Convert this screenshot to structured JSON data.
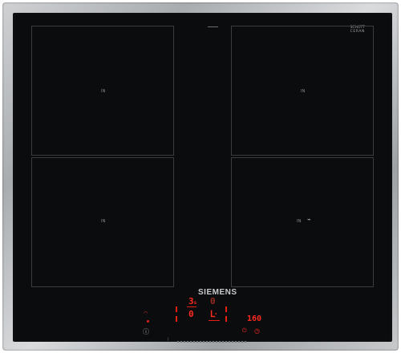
{
  "appliance": {
    "brand": "SIEMENS",
    "glass_mark": [
      "SCHOTT",
      "CERAN"
    ],
    "accent_color": "#e82014"
  },
  "zones": [
    {
      "label": "IN"
    },
    {
      "label": "IN"
    },
    {
      "label": "IN"
    },
    {
      "label": "IN"
    }
  ],
  "controls": {
    "zone_level_top": "3",
    "zone_level_top_suffix": "s",
    "zone_level_left": "0",
    "zone_level_mid": "0",
    "timer_display": "160",
    "wifi_icon": "wifi-icon",
    "info_icon": "info-icon",
    "power_icon": "power-icon",
    "clock_icon": "clock-icon",
    "pan_icon": "pan-icon"
  }
}
